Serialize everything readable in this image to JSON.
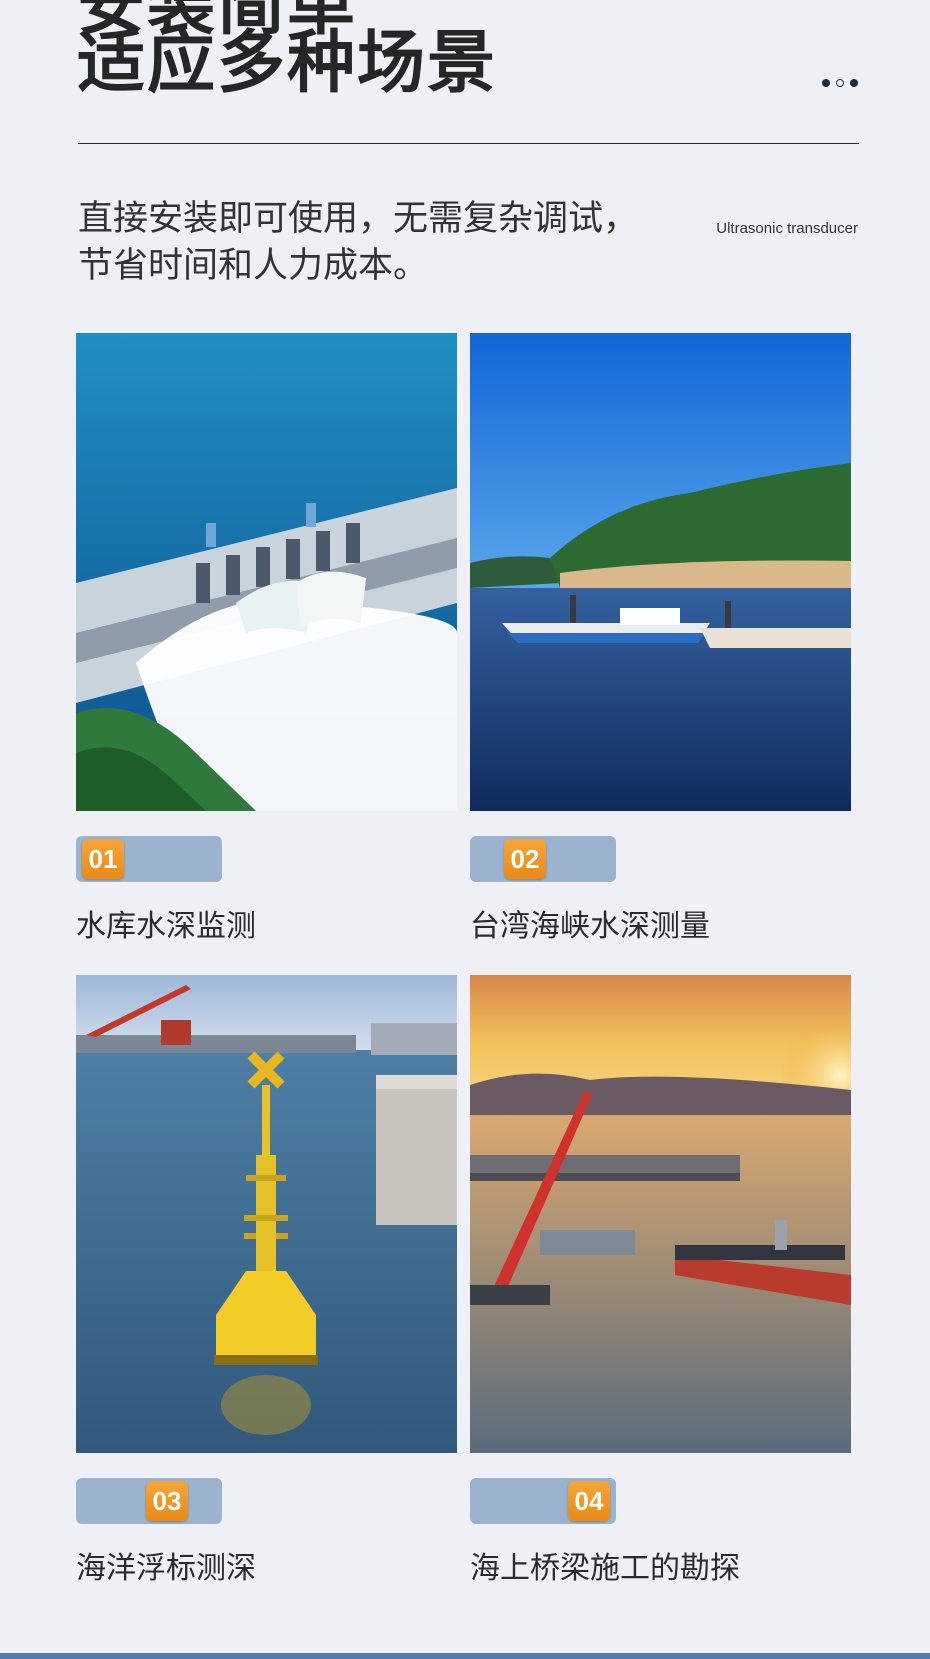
{
  "header": {
    "title_top": "安装简单",
    "title_main": "适应多种场景",
    "subtitle": "Ultrasonic transducer",
    "description_line1": "直接安装即可使用，无需复杂调试，",
    "description_line2": "节省时间和人力成本。"
  },
  "scenarios": [
    {
      "number": "01",
      "caption": "水库水深监测",
      "image": "reservoir-dam-photo"
    },
    {
      "number": "02",
      "caption": "台湾海峡水深测量",
      "image": "strait-boats-photo"
    },
    {
      "number": "03",
      "caption": "海洋浮标测深",
      "image": "ocean-buoy-photo"
    },
    {
      "number": "04",
      "caption": "海上桥梁施工的勘探",
      "image": "bridge-construction-photo"
    }
  ],
  "colors": {
    "background": "#eef0f5",
    "tag": "#9bb3cf",
    "number_badge": "#f39a27",
    "accent": "#1f2a44"
  }
}
